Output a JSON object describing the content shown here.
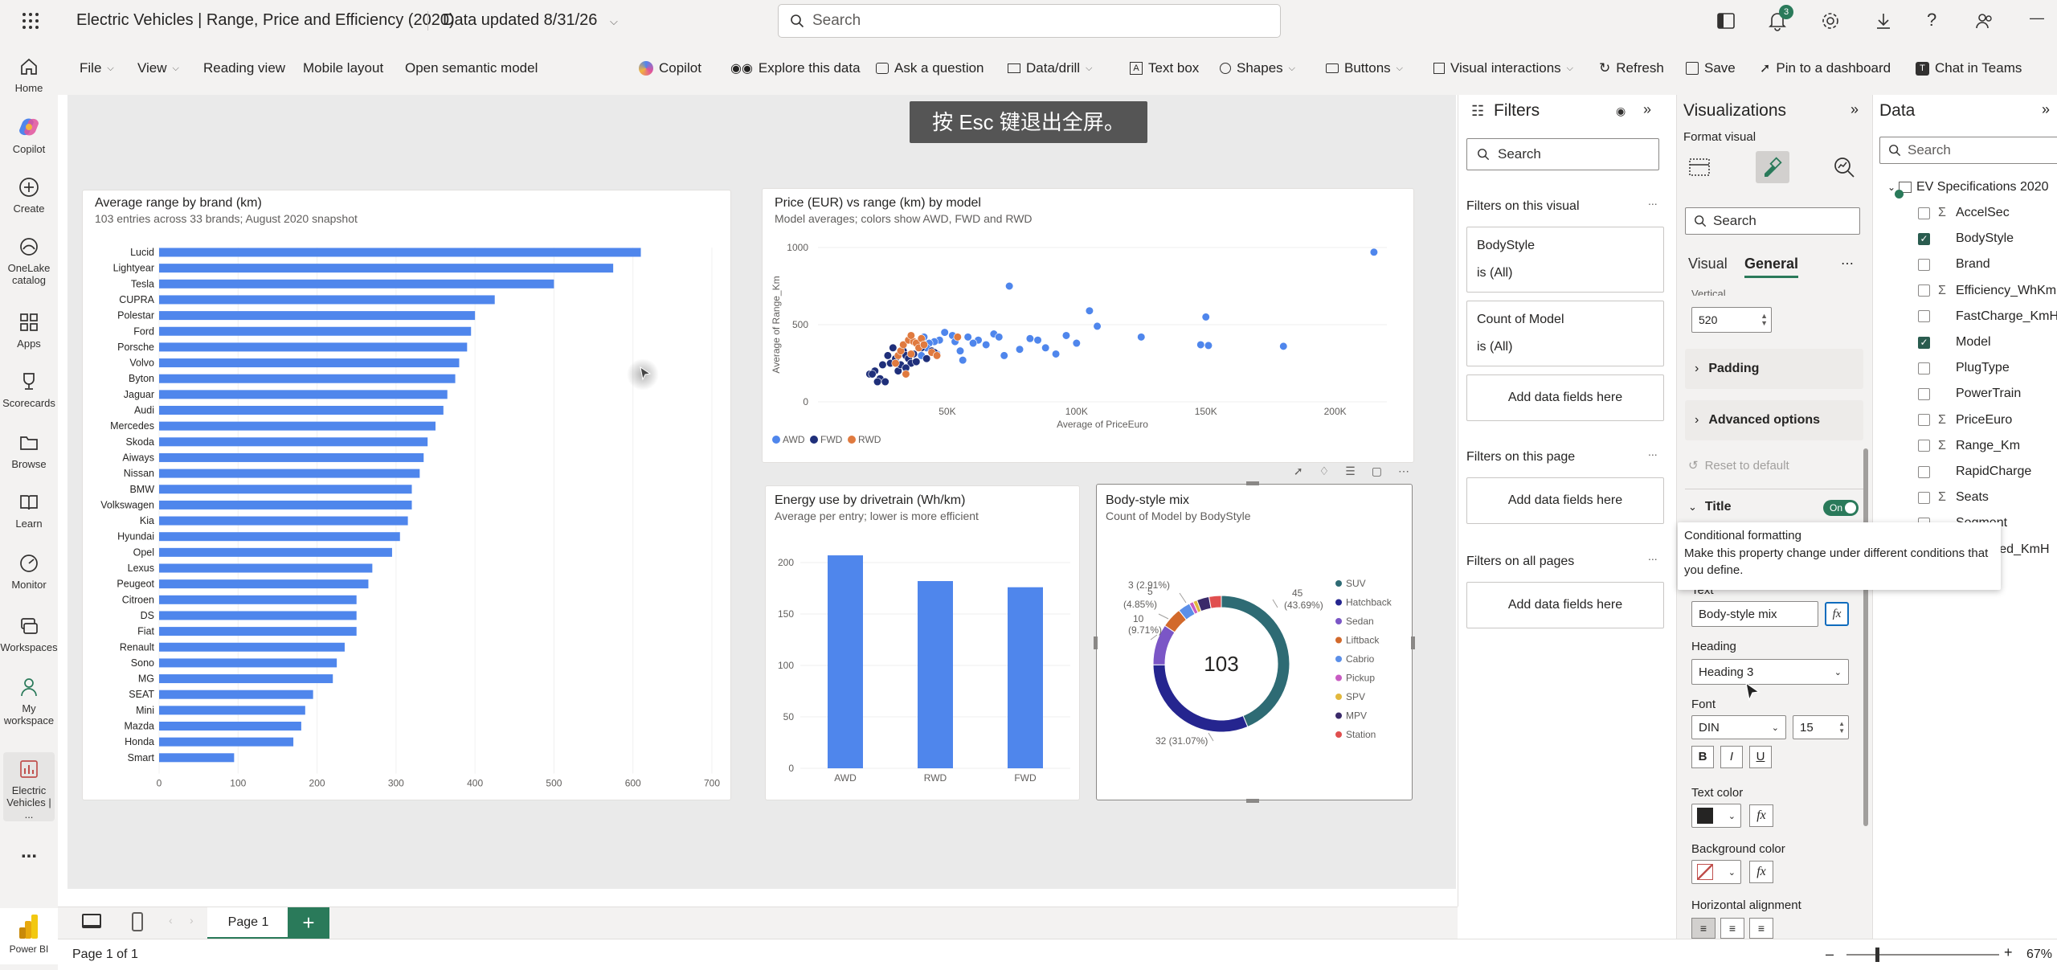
{
  "app": {
    "title": "Electric Vehicles | Range, Price and Efficiency (2020)",
    "data_updated": "Data updated 8/31/26",
    "search_placeholder": "Search",
    "notification_count": "3"
  },
  "left_nav": {
    "items": [
      {
        "label": "Home",
        "icon": "home-icon"
      },
      {
        "label": "Copilot",
        "icon": "copilot-icon"
      },
      {
        "label": "Create",
        "icon": "plus-circle-icon"
      },
      {
        "label": "OneLake catalog",
        "icon": "onelake-icon"
      },
      {
        "label": "Apps",
        "icon": "apps-icon"
      },
      {
        "label": "Scorecards",
        "icon": "trophy-icon"
      },
      {
        "label": "Browse",
        "icon": "folder-icon"
      },
      {
        "label": "Learn",
        "icon": "book-icon"
      },
      {
        "label": "Monitor",
        "icon": "monitor-icon"
      },
      {
        "label": "Workspaces",
        "icon": "workspaces-icon"
      },
      {
        "label": "My workspace",
        "icon": "person-icon"
      },
      {
        "label": "Electric Vehicles | ...",
        "icon": "report-icon"
      }
    ],
    "more": "...",
    "brand": "Power BI"
  },
  "ribbon": {
    "file": "File",
    "view": "View",
    "reading_view": "Reading view",
    "mobile_layout": "Mobile layout",
    "open_semantic_model": "Open semantic model",
    "copilot": "Copilot",
    "explore": "Explore this data",
    "ask": "Ask a question",
    "data_drill": "Data/drill",
    "text_box": "Text box",
    "shapes": "Shapes",
    "buttons": "Buttons",
    "visual_interactions": "Visual interactions",
    "refresh": "Refresh",
    "save": "Save",
    "pin": "Pin to a dashboard",
    "chat": "Chat in Teams"
  },
  "fullscreen_toast": "按 Esc 键退出全屏。",
  "visuals": {
    "bar": {
      "title": "Average range by brand (km)",
      "subtitle": "103 entries across 33 brands; August 2020 snapshot"
    },
    "scatter": {
      "title": "Price (EUR) vs range (km) by model",
      "subtitle": "Model averages; colors show AWD, FWD and RWD"
    },
    "column": {
      "title": "Energy use by drivetrain (Wh/km)",
      "subtitle": "Average per entry; lower is more efficient"
    },
    "donut": {
      "title": "Body-style mix",
      "subtitle": "Count of Model by BodyStyle"
    }
  },
  "chart_data": [
    {
      "type": "bar",
      "orientation": "horizontal",
      "title": "Average range by brand (km)",
      "subtitle": "103 entries across 33 brands; August 2020 snapshot",
      "categories": [
        "Lucid",
        "Lightyear",
        "Tesla",
        "CUPRA",
        "Polestar",
        "Ford",
        "Porsche",
        "Volvo",
        "Byton",
        "Jaguar",
        "Audi",
        "Mercedes",
        "Skoda",
        "Aiways",
        "Nissan",
        "BMW",
        "Volkswagen",
        "Kia",
        "Hyundai",
        "Opel",
        "Lexus",
        "Peugeot",
        "Citroen",
        "DS",
        "Fiat",
        "Renault",
        "Sono",
        "MG",
        "SEAT",
        "Mini",
        "Mazda",
        "Honda",
        "Smart"
      ],
      "values": [
        610,
        575,
        500,
        425,
        400,
        395,
        390,
        380,
        375,
        365,
        360,
        350,
        340,
        335,
        330,
        320,
        320,
        315,
        305,
        295,
        270,
        265,
        250,
        250,
        250,
        235,
        225,
        220,
        195,
        185,
        180,
        170,
        95
      ],
      "xlim": [
        0,
        700
      ],
      "xticks": [
        0,
        100,
        200,
        300,
        400,
        500,
        600,
        700
      ],
      "color": "#4f86ec"
    },
    {
      "type": "scatter",
      "title": "Price (EUR) vs range (km) by model",
      "subtitle": "Model averages; colors show AWD, FWD and RWD",
      "xlabel": "Average of PriceEuro",
      "ylabel": "Average of Range_Km",
      "xlim": [
        0,
        220000
      ],
      "ylim": [
        0,
        1000
      ],
      "xticks": [
        "50K",
        "100K",
        "150K",
        "200K"
      ],
      "yticks": [
        "0",
        "500",
        "1000"
      ],
      "legend": "bottom-left",
      "series": [
        {
          "name": "AWD",
          "color": "#4f86ec",
          "points": [
            [
              215000,
              970
            ],
            [
              74000,
              750
            ],
            [
              96000,
              430
            ],
            [
              105000,
              590
            ],
            [
              108000,
              490
            ],
            [
              125000,
              420
            ],
            [
              150000,
              550
            ],
            [
              148000,
              370
            ],
            [
              151000,
              365
            ],
            [
              180000,
              360
            ],
            [
              100000,
              380
            ],
            [
              92000,
              310
            ],
            [
              88000,
              350
            ],
            [
              82000,
              410
            ],
            [
              78000,
              340
            ],
            [
              72000,
              300
            ],
            [
              68000,
              440
            ],
            [
              65000,
              370
            ],
            [
              62000,
              400
            ],
            [
              58000,
              420
            ],
            [
              55000,
              330
            ],
            [
              52000,
              430
            ],
            [
              49000,
              450
            ],
            [
              47000,
              400
            ],
            [
              45000,
              390
            ],
            [
              43000,
              380
            ],
            [
              42000,
              350
            ],
            [
              41000,
              420
            ],
            [
              40000,
              300
            ],
            [
              46000,
              310
            ],
            [
              56000,
              270
            ],
            [
              60000,
              380
            ],
            [
              70000,
              420
            ],
            [
              85000,
              400
            ],
            [
              53000,
              390
            ]
          ]
        },
        {
          "name": "FWD",
          "color": "#1f2f7a",
          "points": [
            [
              20000,
              180
            ],
            [
              22000,
              200
            ],
            [
              24000,
              150
            ],
            [
              25000,
              240
            ],
            [
              27000,
              300
            ],
            [
              28000,
              250
            ],
            [
              30000,
              280
            ],
            [
              31000,
              200
            ],
            [
              32000,
              240
            ],
            [
              33000,
              330
            ],
            [
              34000,
              300
            ],
            [
              35000,
              280
            ],
            [
              36000,
              250
            ],
            [
              37000,
              310
            ],
            [
              38000,
              260
            ],
            [
              40000,
              350
            ],
            [
              42000,
              280
            ],
            [
              44000,
              330
            ],
            [
              45000,
              320
            ],
            [
              26000,
              130
            ],
            [
              29000,
              350
            ],
            [
              34000,
              220
            ],
            [
              23000,
              130
            ],
            [
              21000,
              180
            ]
          ]
        },
        {
          "name": "RWD",
          "color": "#e07a3f",
          "points": [
            [
              31000,
              300
            ],
            [
              32000,
              330
            ],
            [
              33000,
              370
            ],
            [
              35000,
              400
            ],
            [
              36000,
              310
            ],
            [
              37000,
              390
            ],
            [
              38000,
              380
            ],
            [
              39000,
              350
            ],
            [
              40000,
              410
            ],
            [
              41000,
              370
            ],
            [
              44000,
              320
            ],
            [
              34000,
              180
            ],
            [
              30000,
              250
            ],
            [
              36000,
              430
            ],
            [
              54000,
              420
            ],
            [
              46000,
              300
            ]
          ]
        }
      ]
    },
    {
      "type": "bar",
      "title": "Energy use by drivetrain (Wh/km)",
      "subtitle": "Average per entry; lower is more efficient",
      "categories": [
        "AWD",
        "RWD",
        "FWD"
      ],
      "values": [
        207,
        182,
        176
      ],
      "ylim": [
        0,
        200
      ],
      "yticks": [
        0,
        50,
        100,
        150,
        200
      ],
      "color": "#4f86ec"
    },
    {
      "type": "pie",
      "variant": "donut",
      "title": "Body-style mix",
      "subtitle": "Count of Model by BodyStyle",
      "center_label": "103",
      "categories": [
        "SUV",
        "Hatchback",
        "Sedan",
        "Liftback",
        "Cabrio",
        "Pickup",
        "SPV",
        "MPV",
        "Station"
      ],
      "values": [
        45,
        32,
        10,
        5,
        3,
        1,
        1,
        3,
        3
      ],
      "colors": [
        "#2e6b74",
        "#25258f",
        "#7b56c6",
        "#d2692b",
        "#5b8fe8",
        "#c85bc2",
        "#e2b83d",
        "#3a2a6a",
        "#e04f4f"
      ],
      "data_labels": [
        "45 (43.69%)",
        "32 (31.07%)",
        "10 (9.71%)",
        "5 (4.85%)",
        "3 (2.91%)"
      ],
      "legend": "right"
    }
  ],
  "filters": {
    "title": "Filters",
    "search_placeholder": "Search",
    "on_visual": "Filters on this visual",
    "cards": [
      {
        "name": "BodyStyle",
        "value": "is (All)"
      },
      {
        "name": "Count of Model",
        "value": "is (All)"
      }
    ],
    "add_fields": "Add data fields here",
    "on_page": "Filters on this page",
    "on_all_pages": "Filters on all pages",
    "more": "..."
  },
  "visualizations": {
    "title": "Visualizations",
    "format_visual": "Format visual",
    "search_placeholder": "Search",
    "tab_visual": "Visual",
    "tab_general": "General",
    "vertical_label": "Vertical",
    "vertical_value": "520",
    "padding": "Padding",
    "advanced": "Advanced options",
    "reset": "Reset to default",
    "title_section": "Title",
    "toggle_on": "On",
    "tooltip_title": "Conditional formatting",
    "tooltip_body": "Make this property change under different conditions that you define.",
    "text_label": "Text",
    "text_value": "Body-style mix",
    "heading_label": "Heading",
    "heading_value": "Heading 3",
    "font_label": "Font",
    "font_family": "DIN",
    "font_size": "15",
    "bold": "B",
    "italic": "I",
    "underline": "U",
    "text_color": "Text color",
    "bg_color": "Background color",
    "h_align": "Horizontal alignment",
    "fx": "fx"
  },
  "data_pane": {
    "title": "Data",
    "search_placeholder": "Search",
    "table": "EV Specifications 2020",
    "fields": [
      {
        "name": "AccelSec",
        "sigma": true,
        "checked": false
      },
      {
        "name": "BodyStyle",
        "sigma": false,
        "checked": true
      },
      {
        "name": "Brand",
        "sigma": false,
        "checked": false
      },
      {
        "name": "Efficiency_WhKm",
        "sigma": true,
        "checked": false
      },
      {
        "name": "FastCharge_KmH",
        "sigma": false,
        "checked": false
      },
      {
        "name": "Model",
        "sigma": false,
        "checked": true
      },
      {
        "name": "PlugType",
        "sigma": false,
        "checked": false
      },
      {
        "name": "PowerTrain",
        "sigma": false,
        "checked": false
      },
      {
        "name": "PriceEuro",
        "sigma": true,
        "checked": false
      },
      {
        "name": "Range_Km",
        "sigma": true,
        "checked": false
      },
      {
        "name": "RapidCharge",
        "sigma": false,
        "checked": false
      },
      {
        "name": "Seats",
        "sigma": true,
        "checked": false
      },
      {
        "name": "Segment",
        "sigma": false,
        "checked": false
      },
      {
        "name": "TopSpeed_KmH",
        "sigma": true,
        "checked": false
      }
    ]
  },
  "pages": {
    "tab": "Page 1",
    "status": "Page 1 of 1",
    "zoom": "67%"
  }
}
